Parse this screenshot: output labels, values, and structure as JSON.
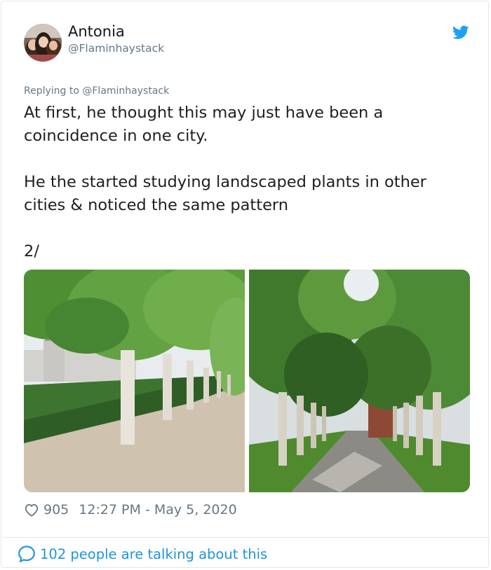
{
  "tweet": {
    "author": {
      "display_name": "Antonia",
      "handle": "@Flaminhaystack"
    },
    "replying_to": "Replying to @Flaminhaystack",
    "text_lines": [
      "At first, he thought this may just have been a coincidence in one city.",
      "He the  started studying landscaped plants in other cities & noticed the same pattern",
      "2/"
    ],
    "images": [
      {
        "description_icon": "photo-trees-hedge-path"
      },
      {
        "description_icon": "photo-tree-lined-avenue"
      }
    ],
    "likes": "905",
    "timestamp": "12:27 PM - May 5, 2020",
    "talking": "102 people are talking about this"
  },
  "colors": {
    "twitter_blue": "#1da1f2",
    "link_blue": "#1b95e0",
    "muted": "#657786",
    "text": "#1c2022"
  },
  "icons": {
    "brand": "twitter-bird-icon",
    "like": "heart-icon",
    "talking": "speech-bubble-icon"
  }
}
